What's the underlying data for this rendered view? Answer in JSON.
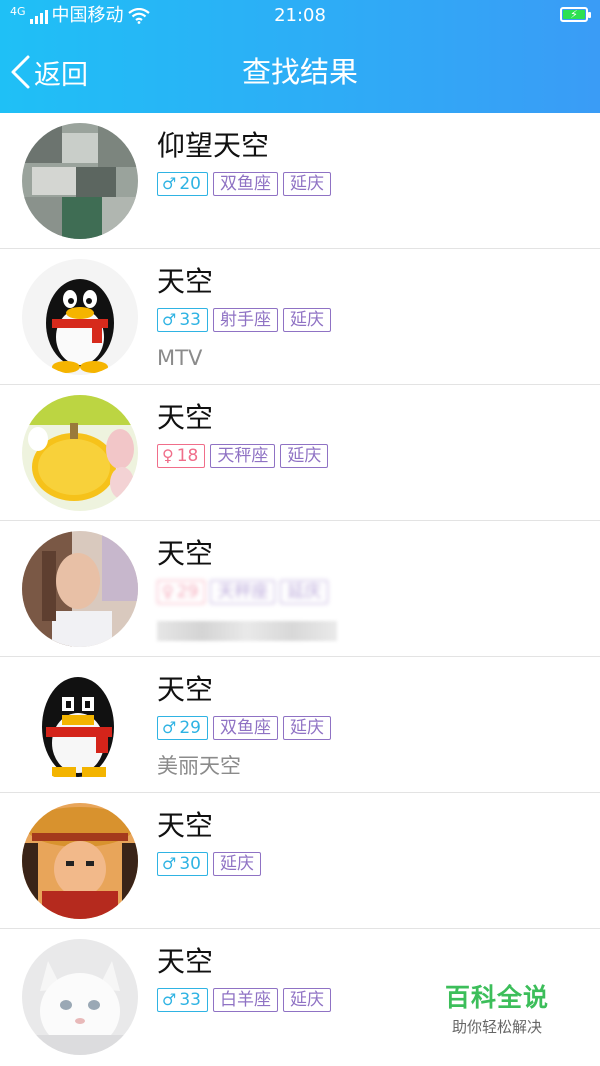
{
  "status_bar": {
    "network": "4G",
    "carrier": "中国移动",
    "time": "21:08",
    "icons": [
      "signal-icon",
      "wifi-icon",
      "battery-charging-icon"
    ]
  },
  "header": {
    "back_label": "返回",
    "title": "查找结果",
    "background": "#2fb3f6"
  },
  "results": [
    {
      "name": "仰望天空",
      "gender": "male",
      "age": "20",
      "tags": [
        "双鱼座",
        "延庆"
      ],
      "signature": ""
    },
    {
      "name": "天空",
      "gender": "male",
      "age": "33",
      "tags": [
        "射手座",
        "延庆"
      ],
      "signature": "MTV"
    },
    {
      "name": "天空",
      "gender": "female",
      "age": "18",
      "tags": [
        "天秤座",
        "延庆"
      ],
      "signature": ""
    },
    {
      "name": "天空",
      "gender": "female",
      "age": "29",
      "tags": [
        "天秤座",
        "延庆"
      ],
      "signature": ""
    },
    {
      "name": "天空",
      "gender": "male",
      "age": "29",
      "tags": [
        "双鱼座",
        "延庆"
      ],
      "signature": "美丽天空"
    },
    {
      "name": "天空",
      "gender": "male",
      "age": "30",
      "tags": [
        "延庆"
      ],
      "signature": ""
    },
    {
      "name": "天空",
      "gender": "male",
      "age": "33",
      "tags": [
        "白羊座",
        "延庆"
      ],
      "signature": ""
    }
  ],
  "gender_symbols": {
    "male": "♂",
    "female": "♀"
  },
  "colors": {
    "male": "#2fb3e3",
    "female": "#f06e8a",
    "tag": "#8f72c4"
  },
  "watermark": {
    "title": "百科全说",
    "subtitle": "助你轻松解决"
  }
}
